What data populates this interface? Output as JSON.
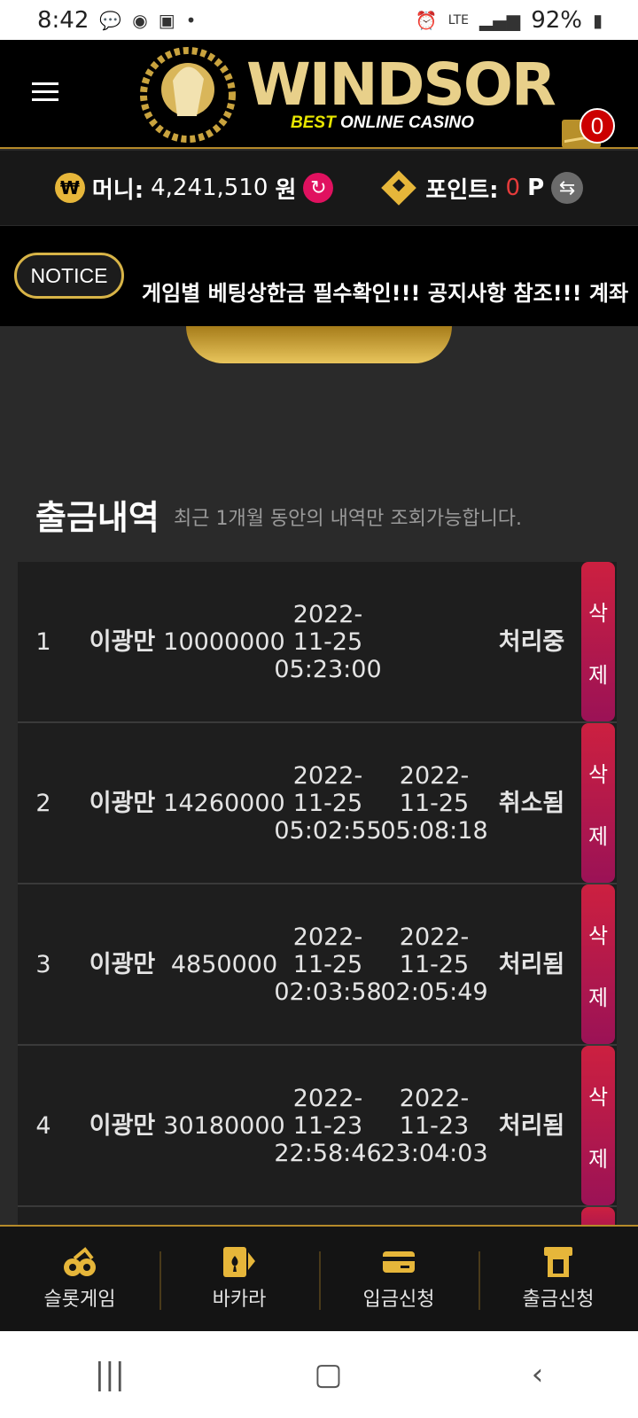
{
  "status_bar": {
    "time": "8:42",
    "battery": "92%",
    "network": "LTE",
    "talk_badge": "TALK"
  },
  "header": {
    "logo_text": "WINDSOR",
    "logo_sub_best": "BEST",
    "logo_sub_rest": " ONLINE CASINO",
    "mail_count": "0"
  },
  "money_bar": {
    "money_label": "머니:",
    "money_value": "4,241,510",
    "money_unit": "원",
    "money_icon_glyph": "₩",
    "points_label": "포인트:",
    "points_value": "0",
    "points_unit": "P"
  },
  "notice": {
    "label": "NOTICE",
    "text": "게임별 베팅상한금 필수확인!!! 공지사항 참조!!! 계좌"
  },
  "section": {
    "title": "출금내역",
    "subtitle": "최근 1개월 동안의 내역만 조회가능합니다."
  },
  "withdrawals": [
    {
      "no": "1",
      "name": "이광만",
      "amount": "10000000",
      "requested": "2022-\n11-25\n05:23:00",
      "processed": "",
      "status": "처리중",
      "delete_top": "삭",
      "delete_bottom": "제"
    },
    {
      "no": "2",
      "name": "이광만",
      "amount": "14260000",
      "requested": "2022-\n11-25\n05:02:55",
      "processed": "2022-\n11-25\n05:08:18",
      "status": "취소됨",
      "delete_top": "삭",
      "delete_bottom": "제"
    },
    {
      "no": "3",
      "name": "이광만",
      "amount": "4850000",
      "requested": "2022-\n11-25\n02:03:58",
      "processed": "2022-\n11-25\n02:05:49",
      "status": "처리됨",
      "delete_top": "삭",
      "delete_bottom": "제"
    },
    {
      "no": "4",
      "name": "이광만",
      "amount": "30180000",
      "requested": "2022-\n11-23\n22:58:46",
      "processed": "2022-\n11-23\n23:04:03",
      "status": "처리됨",
      "delete_top": "삭",
      "delete_bottom": "제"
    }
  ],
  "bottom_nav": [
    {
      "label": "슬롯게임",
      "icon": "slot-icon"
    },
    {
      "label": "바카라",
      "icon": "card-icon"
    },
    {
      "label": "입금신청",
      "icon": "deposit-card-icon"
    },
    {
      "label": "출금신청",
      "icon": "withdraw-atm-icon"
    }
  ],
  "colors": {
    "gold": "#e6b63a",
    "delete_red": "#cc2040",
    "refresh_pink": "#e0115f",
    "background": "#2a2a2a"
  }
}
